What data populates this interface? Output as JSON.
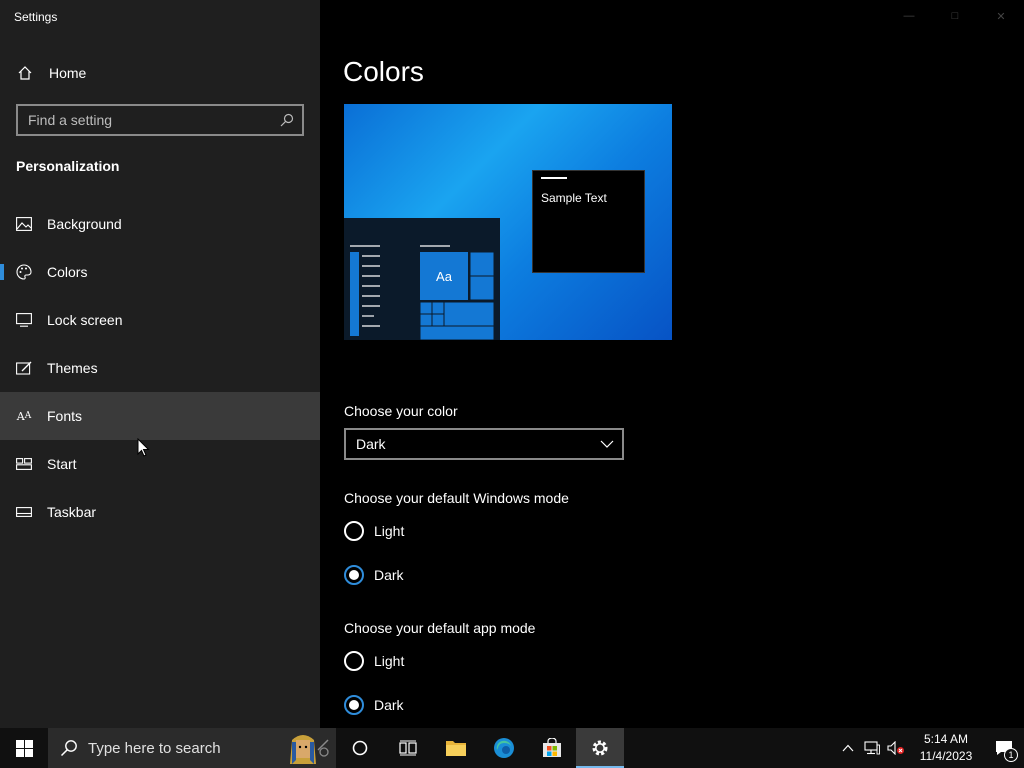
{
  "window": {
    "title": "Settings"
  },
  "sidebar": {
    "home_label": "Home",
    "search_placeholder": "Find a setting",
    "section_title": "Personalization",
    "items": [
      {
        "label": "Background",
        "icon": "image-icon"
      },
      {
        "label": "Colors",
        "icon": "palette-icon",
        "active": true
      },
      {
        "label": "Lock screen",
        "icon": "lock-screen-icon"
      },
      {
        "label": "Themes",
        "icon": "themes-icon"
      },
      {
        "label": "Fonts",
        "icon": "fonts-icon",
        "hover": true
      },
      {
        "label": "Start",
        "icon": "start-icon"
      },
      {
        "label": "Taskbar",
        "icon": "taskbar-icon"
      }
    ]
  },
  "main": {
    "title": "Colors",
    "preview": {
      "sample_text": "Sample Text",
      "tile_text": "Aa"
    },
    "color": {
      "label": "Choose your color",
      "value": "Dark"
    },
    "windows_mode": {
      "label": "Choose your default Windows mode",
      "options": [
        "Light",
        "Dark"
      ],
      "selected": "Dark"
    },
    "app_mode": {
      "label": "Choose your default app mode",
      "options": [
        "Light",
        "Dark"
      ],
      "selected": "Dark"
    }
  },
  "taskbar": {
    "search_placeholder": "Type here to search",
    "time": "5:14 AM",
    "date": "11/4/2023",
    "notification_count": "1"
  },
  "colors": {
    "accent": "#2f8ddb",
    "sidebar_bg": "#1f1f1f",
    "hover_bg": "#3a3a3a"
  }
}
